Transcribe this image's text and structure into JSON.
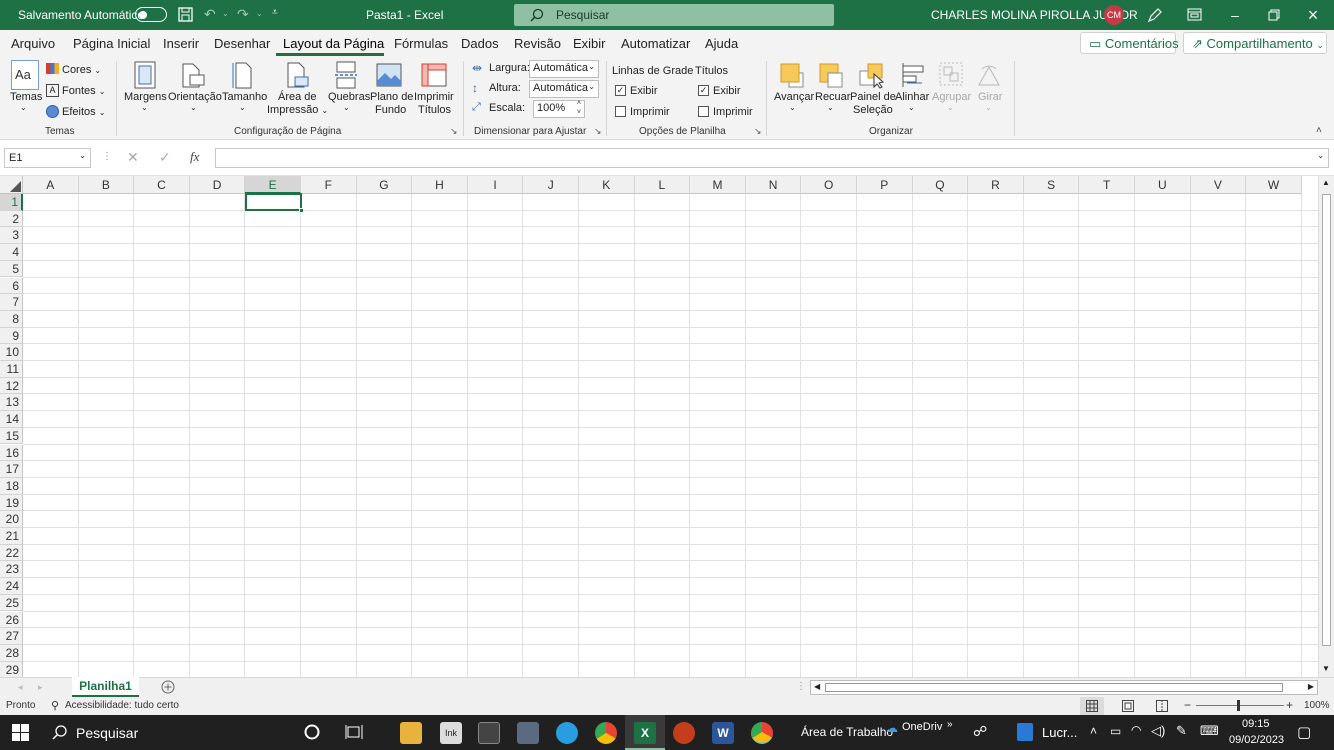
{
  "titlebar": {
    "autosave_label": "Salvamento Automático",
    "doc_title": "Pasta1  -  Excel",
    "search_placeholder": "Pesquisar",
    "user_name": "CHARLES MOLINA PIROLLA JUNIOR",
    "user_initials": "CM"
  },
  "menu": {
    "items": [
      "Arquivo",
      "Página Inicial",
      "Inserir",
      "Desenhar",
      "Layout da Página",
      "Fórmulas",
      "Dados",
      "Revisão",
      "Exibir",
      "Automatizar",
      "Ajuda"
    ],
    "active": "Layout da Página",
    "comments": "Comentários",
    "share": "Compartilhamento"
  },
  "ribbon": {
    "temas": {
      "label": "Temas",
      "cores": "Cores",
      "fontes": "Fontes",
      "efeitos": "Efeitos",
      "group": "Temas"
    },
    "config": {
      "margens": "Margens",
      "orientacao": "Orientação",
      "tamanho": "Tamanho",
      "area1": "Área de",
      "area2": "Impressão",
      "quebras": "Quebras",
      "plano1": "Plano de",
      "plano2": "Fundo",
      "imprimir1": "Imprimir",
      "imprimir2": "Títulos",
      "group": "Configuração de Página"
    },
    "dimensionar": {
      "largura": "Largura:",
      "largura_val": "Automática",
      "altura": "Altura:",
      "altura_val": "Automática",
      "escala": "Escala:",
      "escala_val": "100%",
      "group": "Dimensionar para Ajustar"
    },
    "opcoes": {
      "linhas": "Linhas de Grade",
      "titulos": "Títulos",
      "exibir": "Exibir",
      "imprimir": "Imprimir",
      "group": "Opções de Planilha"
    },
    "organizar": {
      "avancar": "Avançar",
      "recuar": "Recuar",
      "painel1": "Painel de",
      "painel2": "Seleção",
      "alinhar": "Alinhar",
      "agrupar": "Agrupar",
      "girar": "Girar",
      "group": "Organizar"
    }
  },
  "formula_bar": {
    "name_box": "E1",
    "fx": "fx",
    "value": ""
  },
  "grid": {
    "columns": [
      "A",
      "B",
      "C",
      "D",
      "E",
      "F",
      "G",
      "H",
      "I",
      "J",
      "K",
      "L",
      "M",
      "N",
      "O",
      "P",
      "Q",
      "R",
      "S",
      "T",
      "U",
      "V",
      "W"
    ],
    "rows": [
      "1",
      "2",
      "3",
      "4",
      "5",
      "6",
      "7",
      "8",
      "9",
      "10",
      "11",
      "12",
      "13",
      "14",
      "15",
      "16",
      "17",
      "18",
      "19",
      "20",
      "21",
      "22",
      "23",
      "24",
      "25",
      "26",
      "27",
      "28",
      "29"
    ],
    "selected_cell": "E1"
  },
  "sheets": {
    "tabs": [
      "Planilha1"
    ],
    "active": "Planilha1"
  },
  "status": {
    "ready": "Pronto",
    "accessibility": "Acessibilidade: tudo certo",
    "zoom": "100%"
  },
  "taskbar": {
    "search": "Pesquisar",
    "desktop": "Área de Trabalho",
    "onedrive": "OneDriv",
    "lucr": "Lucr...",
    "time": "09:15",
    "date": "09/02/2023"
  },
  "colors": {
    "excel_green": "#1e7145",
    "avatar": "#c43b47",
    "taskbar": "#202020"
  }
}
